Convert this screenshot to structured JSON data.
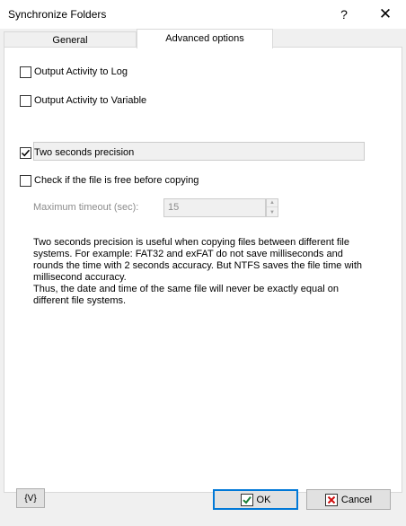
{
  "window": {
    "title": "Synchronize Folders",
    "help_glyph": "?",
    "close_glyph": "✕"
  },
  "tabs": [
    {
      "label": "General",
      "selected": false
    },
    {
      "label": "Advanced options",
      "selected": true
    }
  ],
  "options": {
    "output_log": {
      "label": "Output Activity to Log",
      "checked": false
    },
    "output_variable": {
      "label": "Output Activity to Variable",
      "checked": false,
      "value": ""
    },
    "two_seconds": {
      "label": "Two seconds precision",
      "checked": true
    },
    "check_free": {
      "label": "Check if the file is free before copying",
      "checked": false
    }
  },
  "timeout": {
    "label": "Maximum timeout (sec):",
    "value": "15",
    "enabled": false
  },
  "info_text": "Two seconds precision is useful when copying files between different file systems. For example: FAT32 and exFAT do not save milliseconds and rounds the time with 2 seconds accuracy. But NTFS saves the file time with millisecond accuracy.\nThus, the date and time of the same file will never be exactly equal on different file systems.",
  "buttons": {
    "variable": "{V}",
    "ok": "OK",
    "cancel": "Cancel"
  },
  "colors": {
    "ok_border": "#0078d7",
    "ok_check": "#1a7f37",
    "cancel_x": "#d01010"
  }
}
